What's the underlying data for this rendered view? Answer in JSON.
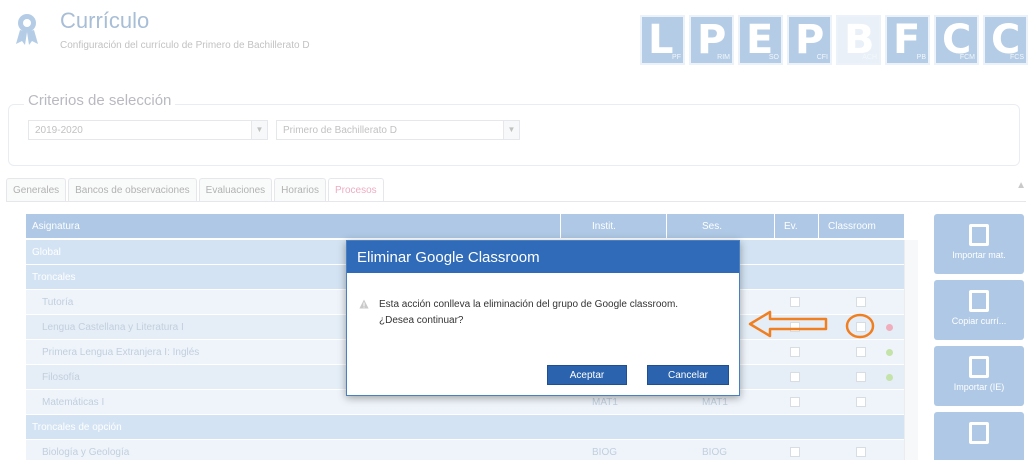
{
  "header": {
    "title": "Currículo",
    "subtitle": "Configuración del currículo de Primero de Bachillerato D"
  },
  "logos": [
    {
      "letter": "L",
      "tag": "PF"
    },
    {
      "letter": "P",
      "tag": "RIM"
    },
    {
      "letter": "E",
      "tag": "SO"
    },
    {
      "letter": "P",
      "tag": "CFI"
    },
    {
      "letter": "B",
      "tag": "ACH"
    },
    {
      "letter": "F",
      "tag": "PB"
    },
    {
      "letter": "C",
      "tag": "FCM"
    },
    {
      "letter": "C",
      "tag": "FCS"
    }
  ],
  "criteria": {
    "legend": "Criterios de selección",
    "year": "2019-2020",
    "group": "Primero de Bachillerato D"
  },
  "tabs": [
    "Generales",
    "Bancos de observaciones",
    "Evaluaciones",
    "Horarios",
    "Procesos"
  ],
  "grid": {
    "headers": [
      "Asignatura",
      "Instit.",
      "Ses.",
      "Ev.",
      "Classroom"
    ],
    "rows": [
      {
        "kind": "group",
        "name": "Global"
      },
      {
        "kind": "group",
        "name": "Troncales"
      },
      {
        "kind": "data",
        "name": "Tutoría"
      },
      {
        "kind": "data",
        "name": "Lengua Castellana y Literatura I"
      },
      {
        "kind": "data",
        "name": "Primera Lengua Extranjera I: Inglés"
      },
      {
        "kind": "data",
        "name": "Filosofía"
      },
      {
        "kind": "data",
        "name": "Matemáticas I",
        "inst": "MAT1",
        "ses": "MAT1"
      },
      {
        "kind": "group",
        "name": "Troncales de opción"
      },
      {
        "kind": "data",
        "name": "Biología y Geología",
        "inst": "BIOG",
        "ses": "BIOG"
      }
    ]
  },
  "side_buttons": [
    "Importar mat.",
    "Copiar currí...",
    "Importar (IE)"
  ],
  "dialog": {
    "title": "Eliminar Google Classroom",
    "line1": "Esta acción conlleva la eliminación del grupo de Google classroom.",
    "line2": "¿Desea continuar?",
    "accept": "Aceptar",
    "cancel": "Cancelar"
  },
  "colors": {
    "accent": "#2f6bb8",
    "annotation": "#f07f22"
  }
}
